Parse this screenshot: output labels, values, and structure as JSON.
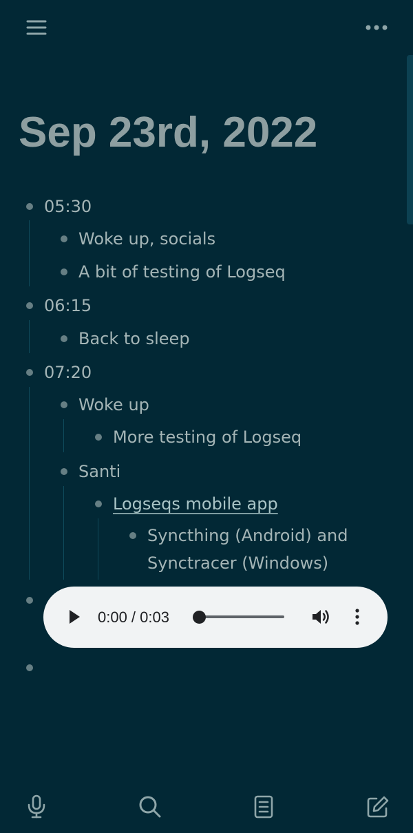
{
  "header": {
    "menu_icon": "hamburger-menu-icon",
    "more_icon": "more-horizontal-icon"
  },
  "page": {
    "title": "Sep 23rd, 2022"
  },
  "blocks": {
    "b1": {
      "text": "05:30"
    },
    "b1_1": {
      "text": "Woke up, socials"
    },
    "b1_2": {
      "text": "A bit of testing of Logseq"
    },
    "b2": {
      "text": "06:15"
    },
    "b2_1": {
      "text": "Back to sleep"
    },
    "b3": {
      "text": "07:20"
    },
    "b3_1": {
      "text": "Woke up"
    },
    "b3_1_1": {
      "text": "More testing of Logseq"
    },
    "b3_2": {
      "text": "Santi"
    },
    "b3_2_1": {
      "text": "Logseqs mobile app"
    },
    "b3_2_1_1": {
      "line1": "Syncthing (Android) and",
      "line2": "Synctracer (Windows)"
    }
  },
  "audio": {
    "time": "0:00 / 0:03",
    "progress_fraction": 0,
    "icons": [
      "play-icon",
      "volume-icon",
      "more-vertical-icon"
    ]
  },
  "bottom_bar": {
    "icons": [
      "microphone-icon",
      "search-icon",
      "document-icon",
      "edit-icon"
    ]
  },
  "colors": {
    "background": "#022835",
    "text": "#a4b5b6",
    "title": "#8e9fa1",
    "bullet": "#667f84",
    "icon": "#8fa6a9",
    "player_bg": "#f1f3f4"
  }
}
